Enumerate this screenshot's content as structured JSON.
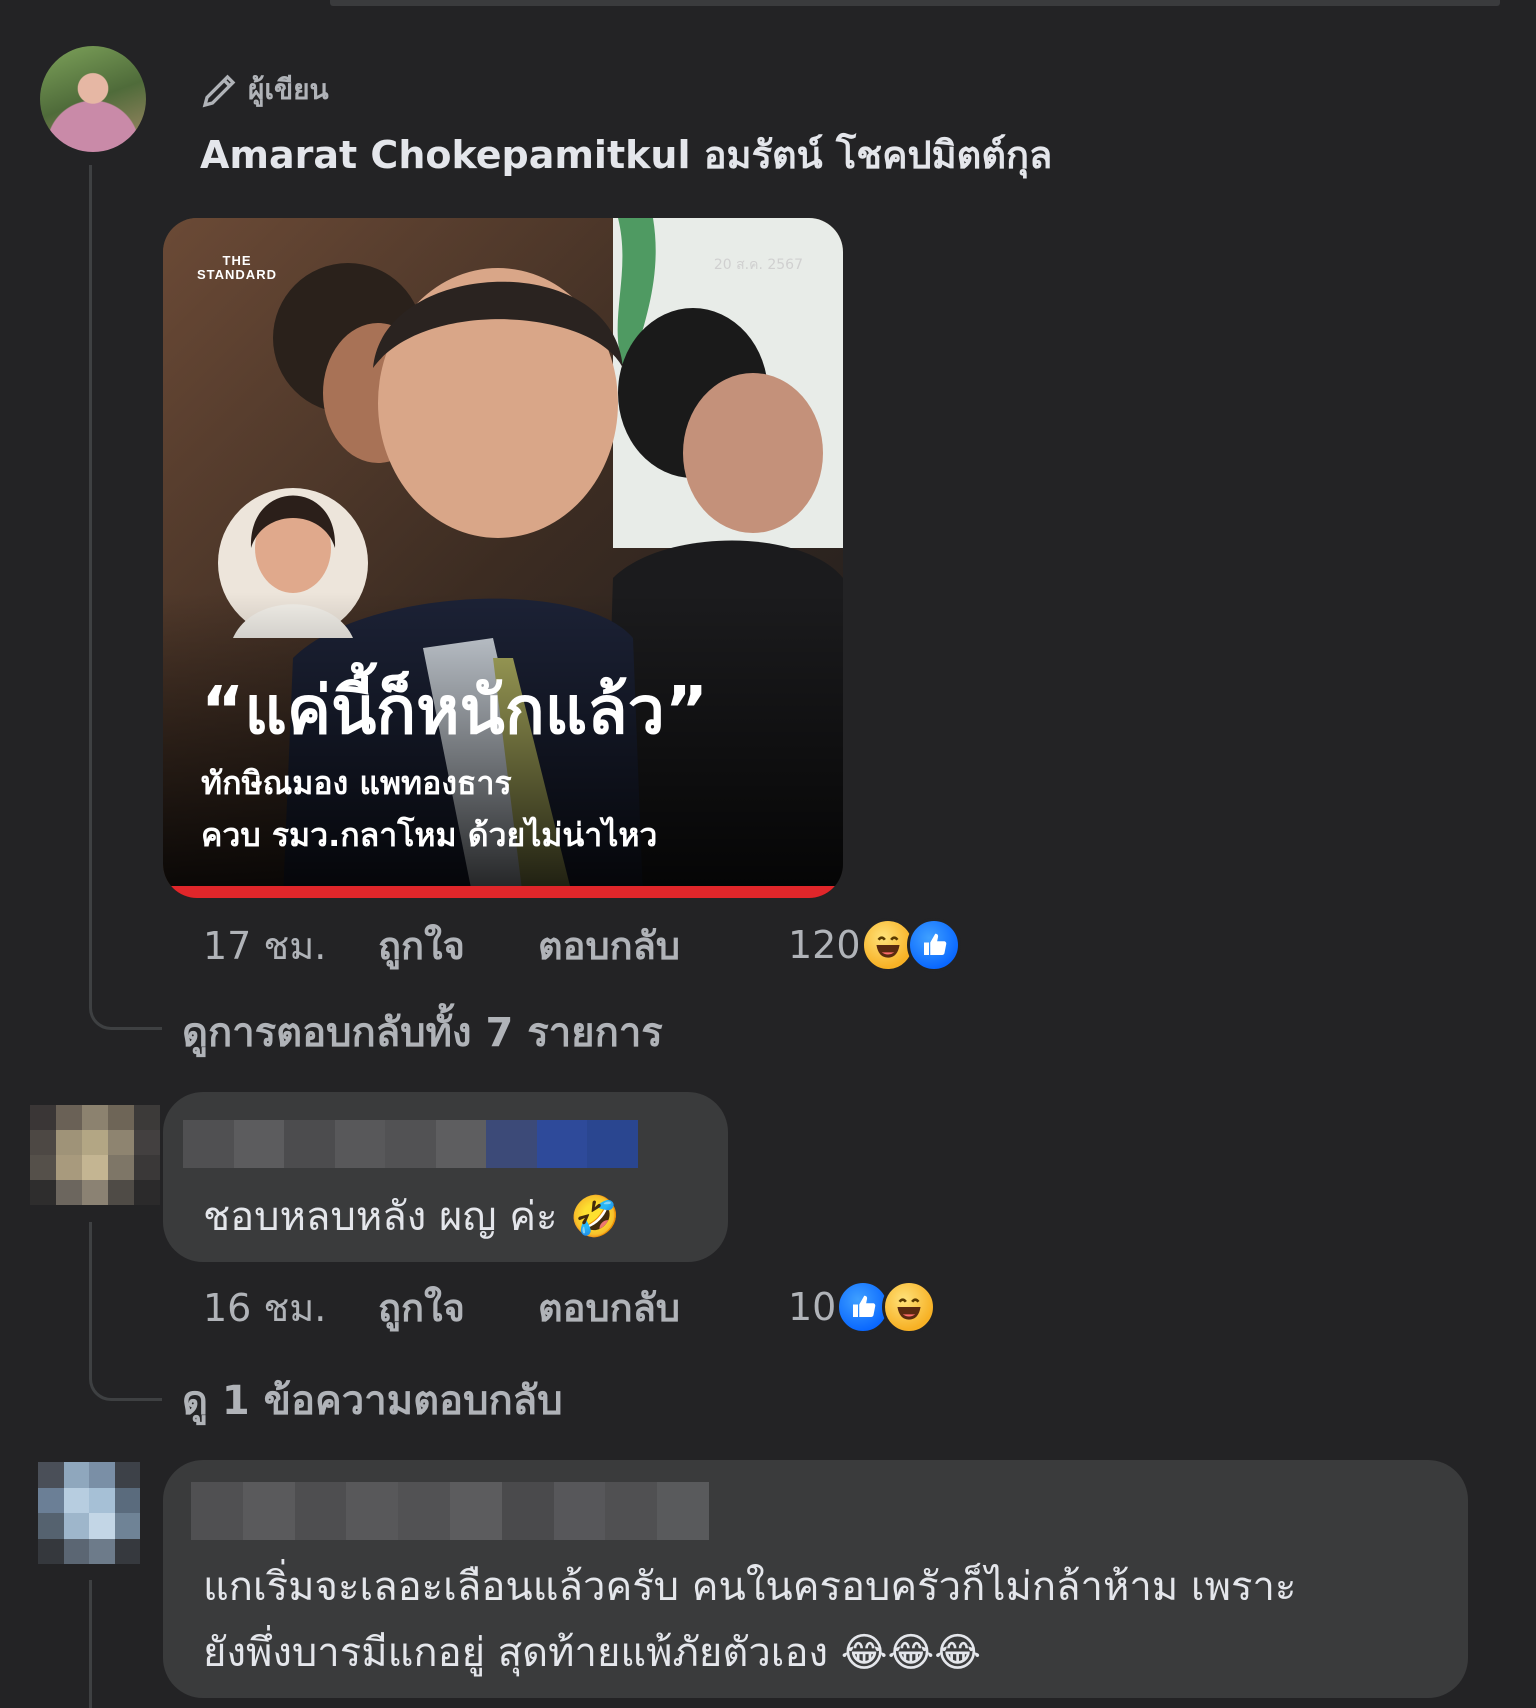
{
  "comment1": {
    "author_badge": "ผู้เขียน",
    "author_name": "Amarat Chokepamitkul อมรัตน์ โชคปมิตต์กุล",
    "image": {
      "brand": "THE STANDARD",
      "date": "20 ส.ค. 2567",
      "headline": "“แค่นี้ก็หนักแล้ว”",
      "subline1": "ทักษิณมอง แพทองธาร",
      "subline2": "ควบ รมว.กลาโหม ด้วยไม่น่าไหว"
    },
    "time": "17 ชม.",
    "like": "ถูกใจ",
    "reply": "ตอบกลับ",
    "reactions_count": "120",
    "view_replies": "ดูการตอบกลับทั้ง 7 รายการ"
  },
  "comment2": {
    "text": "ชอบหลบหลัง ผญ ค่ะ 🤣",
    "time": "16 ชม.",
    "like": "ถูกใจ",
    "reply": "ตอบกลับ",
    "reactions_count": "10",
    "view_replies": "ดู 1 ข้อความตอบกลับ"
  },
  "comment3": {
    "line1": "แกเริ่มจะเลอะเลือนแล้วครับ คนในครอบครัวก็ไม่กล้าห้าม เพราะ",
    "line2": "ยังพึ่งบารมีแกอยู่ สุดท้ายแพ้ภัยตัวเอง 😂😂😂"
  },
  "icons": [
    "pencil-icon",
    "haha-reaction-icon",
    "like-reaction-icon"
  ],
  "colors": {
    "background": "#232325",
    "bubble": "#3a3b3c",
    "muted_text": "#b0b3b8",
    "like_blue": "#0866ff",
    "haha_yellow": "#f7b125"
  }
}
